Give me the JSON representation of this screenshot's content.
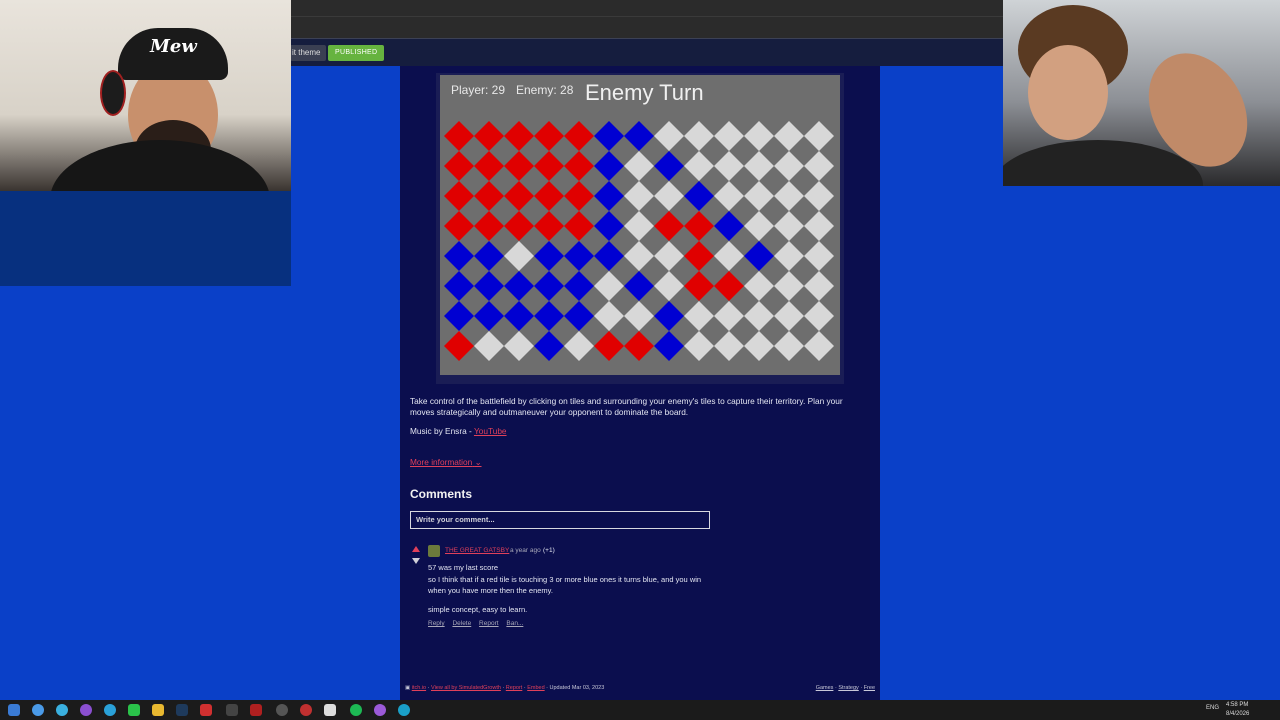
{
  "editor": {
    "theme_label": "it theme",
    "published_label": "PUBLISHED"
  },
  "webcam_left": {
    "cap_text": "Mew"
  },
  "game": {
    "player_label": "Player: 29",
    "enemy_label": "Enemy: 28",
    "turn_label": "Enemy Turn",
    "colors": {
      "red": "#e00000",
      "blue": "#0000d2",
      "white": "#d8d8d8",
      "bg": "#6e6e6e"
    },
    "grid": [
      "RRRRRBBWWWWWW",
      "RRRRRBWBWWWWW",
      "RRRRRBWWBWWWW",
      "RRRRRBWRRBWWW",
      "BBWBBBWWRWBWW",
      "BBBBBWBWRRWWW",
      "BBBBBWWBWWWWW",
      "RWWBWRRBWWWWW"
    ]
  },
  "description": {
    "text": "Take control of the battlefield by clicking on tiles and surrounding your enemy's tiles to capture their territory. Plan your moves strategically and outmaneuver your opponent to dominate the board.",
    "music_prefix": "Music by Ensra - ",
    "music_link": "YouTube",
    "more_info": "More information"
  },
  "comments": {
    "heading": "Comments",
    "input_placeholder": "Write your comment...",
    "items": [
      {
        "author": "THE GREAT GATSBY",
        "time": "a year ago",
        "votes": "(+1)",
        "lines": [
          "57 was my last score",
          "so I think that if a red tile is touching 3 or more blue ones it turns blue, and you win",
          "when you have more then the enemy.",
          "simple concept, easy to learn."
        ],
        "actions": [
          "Reply",
          "Delete",
          "Report",
          "Ban..."
        ]
      }
    ]
  },
  "footer": {
    "left_links": [
      "itch.io",
      "View all by SimulatedGrowth",
      "Report",
      "Embed"
    ],
    "updated": "Updated Mar 03, 2023",
    "right_links": [
      "Games",
      "Strategy",
      "Free"
    ]
  },
  "taskbar": {
    "lang": "ENG",
    "time": "4:58 PM",
    "date": "8/4/2026"
  }
}
